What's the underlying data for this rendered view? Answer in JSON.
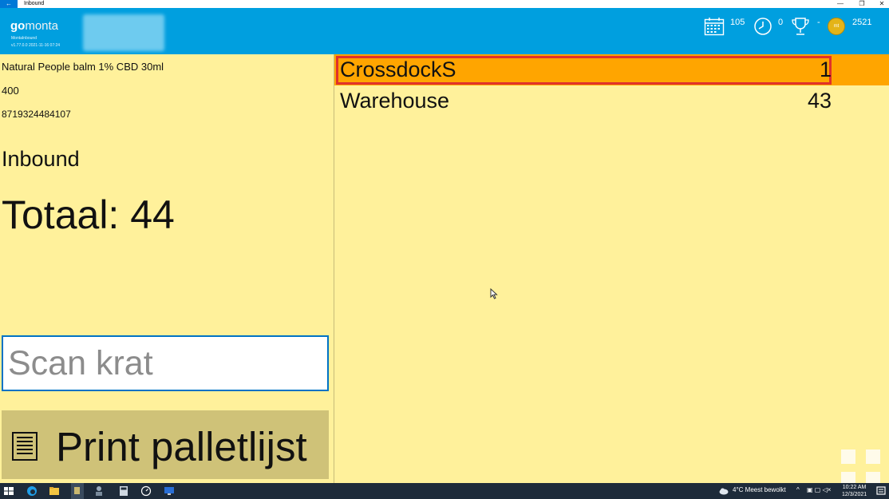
{
  "window": {
    "title": "Inbound",
    "back_glyph": "←",
    "min_glyph": "—",
    "max_glyph": "❐",
    "close_glyph": "✕"
  },
  "header": {
    "logo_go": "go",
    "logo_monta": "monta",
    "app_name": "MontaInbound",
    "version": "v1.77.0.0   2021-11-16 07:24",
    "calendar_count": "105",
    "clock_count": "0",
    "trophy_value": "-",
    "coin_label": "mt",
    "coin_count": "2521",
    "bg_color": "#009fdf"
  },
  "product": {
    "name": "Natural People balm 1% CBD 30ml",
    "quantity": "400",
    "ean": "8719324484107"
  },
  "main": {
    "section_title": "Inbound",
    "total": "Totaal: 44",
    "scan_placeholder": "Scan krat",
    "print_label": "Print palletlijst"
  },
  "locations": [
    {
      "name": "CrossdockS",
      "count": "1",
      "selected": true
    },
    {
      "name": "Warehouse",
      "count": "43",
      "selected": false
    }
  ],
  "taskbar": {
    "weather": "4°C  Meest bewolkt",
    "time": "10:22 AM",
    "date": "12/3/2021"
  },
  "colors": {
    "panel_bg": "#fff19b",
    "selected_row": "#ffa500",
    "selected_outline": "#e0322a",
    "print_button": "#cfc278"
  }
}
